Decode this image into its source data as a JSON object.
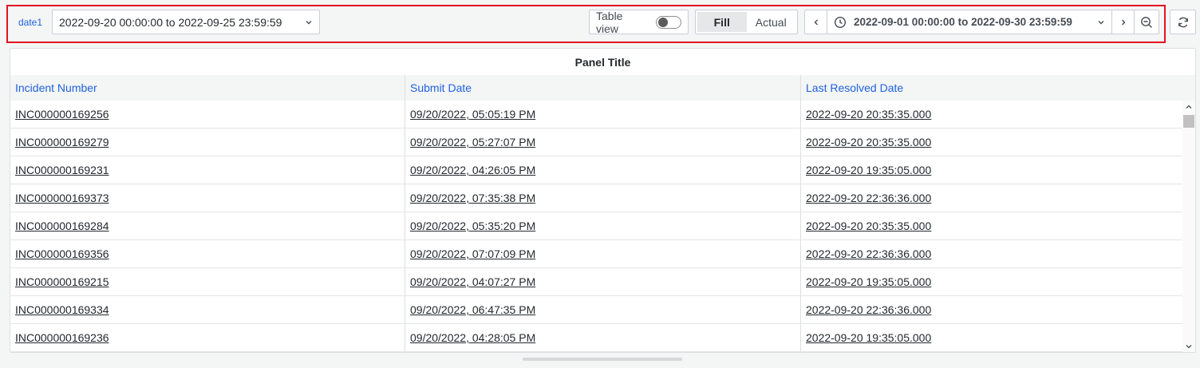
{
  "toolbar": {
    "variable_label": "date1",
    "variable_value": "2022-09-20 00:00:00 to 2022-09-25 23:59:59",
    "table_view_label": "Table view",
    "fill_label": "Fill",
    "actual_label": "Actual",
    "time_range": "2022-09-01 00:00:00 to 2022-09-30 23:59:59"
  },
  "panel": {
    "title": "Panel Title",
    "columns": [
      "Incident Number",
      "Submit Date",
      "Last Resolved Date"
    ],
    "rows": [
      [
        "INC000000169256",
        "09/20/2022, 05:05:19 PM",
        "2022-09-20 20:35:35.000"
      ],
      [
        "INC000000169279",
        "09/20/2022, 05:27:07 PM",
        "2022-09-20 20:35:35.000"
      ],
      [
        "INC000000169231",
        "09/20/2022, 04:26:05 PM",
        "2022-09-20 19:35:05.000"
      ],
      [
        "INC000000169373",
        "09/20/2022, 07:35:38 PM",
        "2022-09-20 22:36:36.000"
      ],
      [
        "INC000000169284",
        "09/20/2022, 05:35:20 PM",
        "2022-09-20 20:35:35.000"
      ],
      [
        "INC000000169356",
        "09/20/2022, 07:07:09 PM",
        "2022-09-20 22:36:36.000"
      ],
      [
        "INC000000169215",
        "09/20/2022, 04:07:27 PM",
        "2022-09-20 19:35:05.000"
      ],
      [
        "INC000000169334",
        "09/20/2022, 06:47:35 PM",
        "2022-09-20 22:36:36.000"
      ],
      [
        "INC000000169236",
        "09/20/2022, 04:28:05 PM",
        "2022-09-20 19:35:05.000"
      ]
    ]
  },
  "colors": {
    "highlight": "#e0141e",
    "link": "#1f62e0"
  }
}
